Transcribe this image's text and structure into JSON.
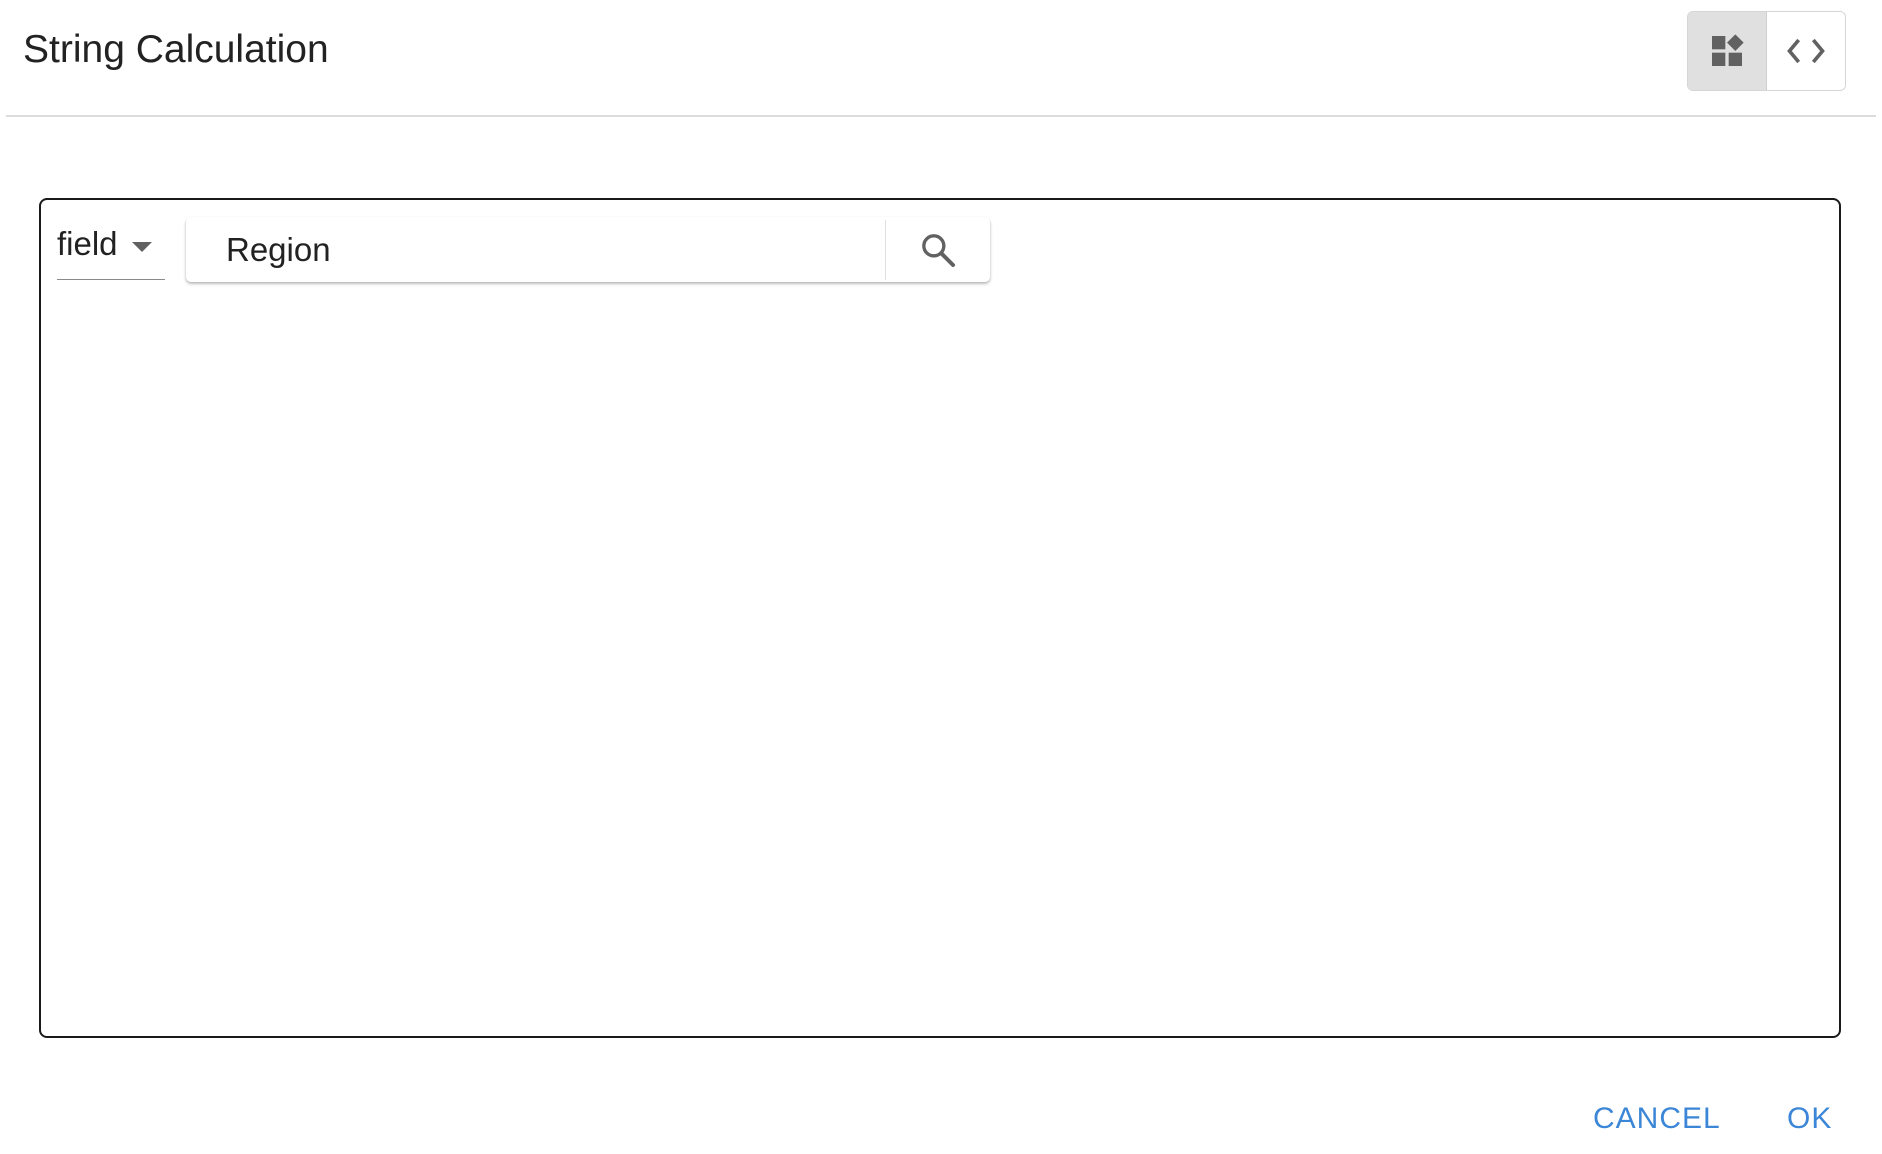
{
  "dialog": {
    "title": "String Calculation"
  },
  "mode_toggle": {
    "active_mode": "visual",
    "buttons": [
      {
        "icon": "widgets-icon",
        "mode": "visual"
      },
      {
        "icon": "code-icon",
        "mode": "code"
      }
    ]
  },
  "editor": {
    "type_select": {
      "value": "field"
    },
    "search": {
      "value": "Region",
      "icon": "search-icon"
    }
  },
  "footer": {
    "cancel_label": "CANCEL",
    "ok_label": "OK"
  },
  "colors": {
    "accent": "#3b86d6",
    "active_toggle_bg": "#e0e0e0",
    "icon": "#616161"
  }
}
